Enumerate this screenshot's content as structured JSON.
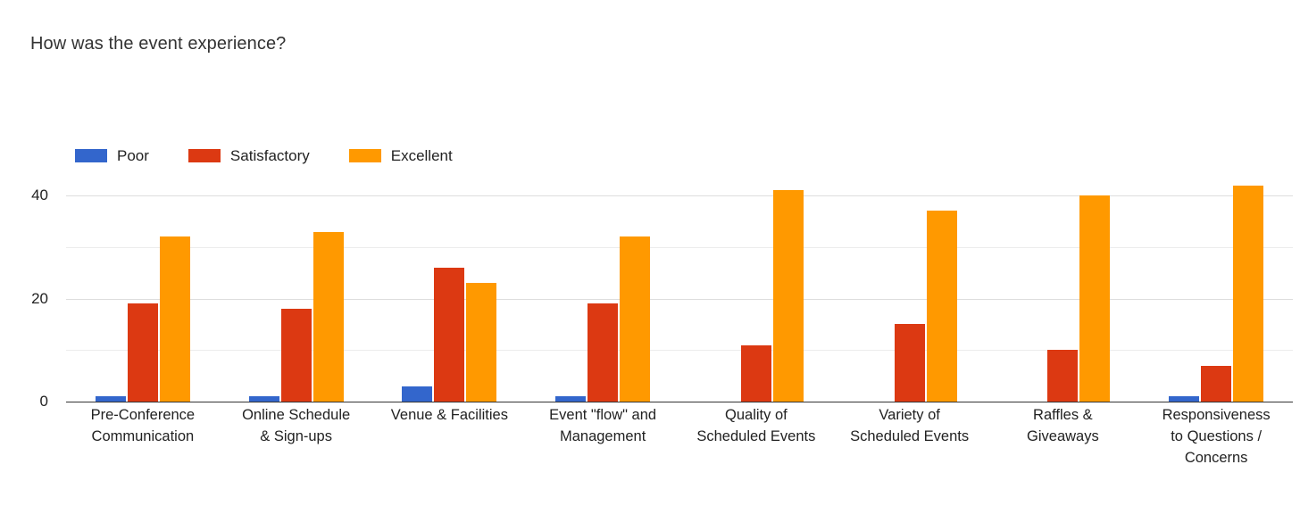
{
  "chart_data": {
    "type": "bar",
    "title": "How was the event experience?",
    "xlabel": "",
    "ylabel": "",
    "ylim": [
      0,
      42
    ],
    "y_axis_max": 44,
    "yticks": [
      0,
      20,
      40
    ],
    "ytick_labels": [
      "0",
      "20",
      "40"
    ],
    "gridlines": [
      0,
      10,
      20,
      30,
      40
    ],
    "grid": true,
    "legend_position": "top-left",
    "categories": [
      "Pre-Conference Communication",
      "Online Schedule & Sign-ups",
      "Venue & Facilities",
      "Event \"flow\" and Management",
      "Quality of Scheduled Events",
      "Variety of Scheduled Events",
      "Raffles & Giveaways",
      "Responsiveness to Questions / Concerns"
    ],
    "category_lines": [
      [
        "Pre-Conference",
        "Communication"
      ],
      [
        "Online Schedule",
        "& Sign-ups"
      ],
      [
        "Venue & Facilities"
      ],
      [
        "Event \"flow\" and",
        "Management"
      ],
      [
        "Quality of",
        "Scheduled Events"
      ],
      [
        "Variety of",
        "Scheduled Events"
      ],
      [
        "Raffles &",
        "Giveaways"
      ],
      [
        "Responsiveness",
        "to Questions /",
        "Concerns"
      ]
    ],
    "series": [
      {
        "name": "Poor",
        "color": "#3366cc",
        "values": [
          1,
          1,
          3,
          1,
          0,
          0,
          0,
          1
        ]
      },
      {
        "name": "Satisfactory",
        "color": "#dc3912",
        "values": [
          19,
          18,
          26,
          19,
          11,
          15,
          10,
          7
        ]
      },
      {
        "name": "Excellent",
        "color": "#ff9900",
        "values": [
          32,
          33,
          23,
          32,
          41,
          37,
          40,
          42
        ]
      }
    ]
  },
  "legend": {
    "items": [
      {
        "label": "Poor",
        "color": "#3366cc"
      },
      {
        "label": "Satisfactory",
        "color": "#dc3912"
      },
      {
        "label": "Excellent",
        "color": "#ff9900"
      }
    ]
  }
}
